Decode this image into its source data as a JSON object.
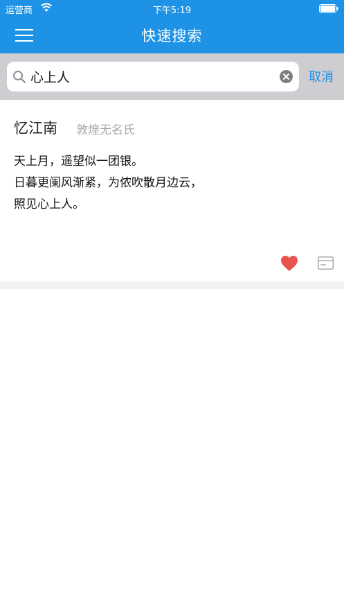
{
  "status_bar": {
    "carrier": "运营商",
    "time": "下午5:19"
  },
  "nav": {
    "title": "快速搜索",
    "menu_icon": "hamburger-menu-icon"
  },
  "search": {
    "value": "心上人",
    "cancel_label": "取消",
    "search_icon": "magnifier-icon",
    "clear_icon": "clear-circle-icon"
  },
  "poem": {
    "title": "忆江南",
    "author": "敦煌无名氏",
    "lines": [
      "天上月，遥望似一团银。",
      "日暮更阑风渐紧，为侬吹散月边云，",
      "照见心上人。"
    ],
    "favorite_icon": "heart-icon",
    "card_icon": "card-icon"
  },
  "colors": {
    "accent": "#1e93e6",
    "favorite": "#e8524f",
    "search_bar_bg": "#cdcdd2"
  }
}
